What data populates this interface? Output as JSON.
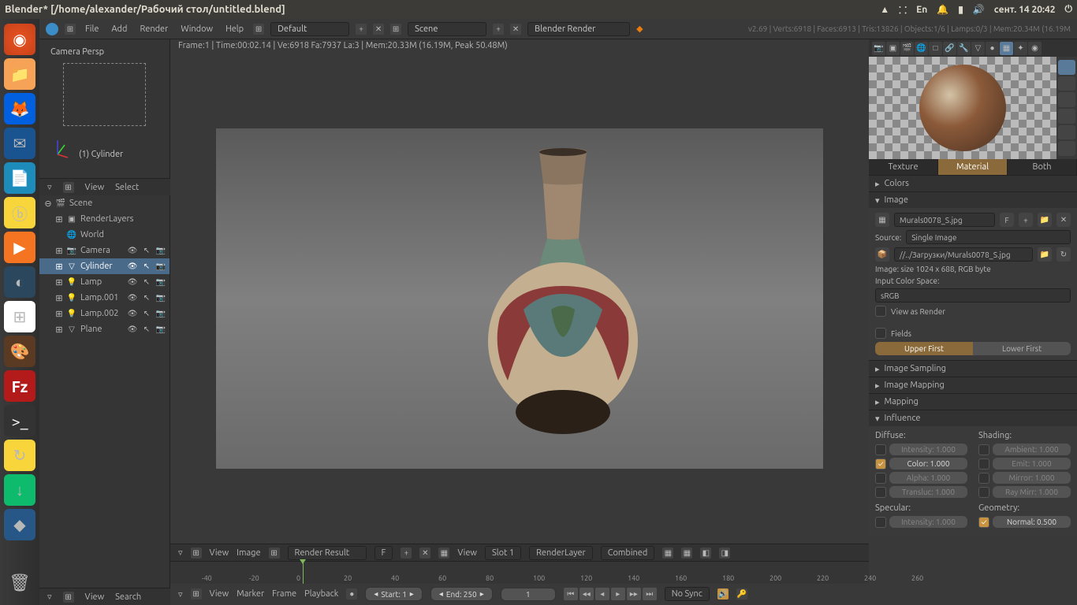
{
  "titlebar": {
    "text": "Blender* [/home/alexander/Рабочий стол/untitled.blend]",
    "lang": "En",
    "datetime": "сент. 14 20:42"
  },
  "toolbar": {
    "menus": [
      "File",
      "Add",
      "Render",
      "Window",
      "Help"
    ],
    "layout": "Default",
    "scene": "Scene",
    "engine": "Blender Render",
    "stats": "v2.69 | Verts:6918 | Faces:6913 | Tris:13826 | Objects:1/6 | Lamps:0/3 | Mem:20.34M (16.19M"
  },
  "camera": {
    "label": "Camera Persp",
    "name": "(1) Cylinder"
  },
  "outliner": {
    "header": [
      "View",
      "Select"
    ],
    "items": [
      {
        "name": "Scene",
        "icon": "🎬",
        "indent": 0,
        "toggle": "⊖",
        "ctrls": false
      },
      {
        "name": "RenderLayers",
        "icon": "▣",
        "indent": 1,
        "toggle": "⊞",
        "ctrls": false
      },
      {
        "name": "World",
        "icon": "🌐",
        "indent": 1,
        "toggle": "",
        "ctrls": false
      },
      {
        "name": "Camera",
        "icon": "📷",
        "indent": 1,
        "toggle": "⊞",
        "ctrls": true
      },
      {
        "name": "Cylinder",
        "icon": "▽",
        "indent": 1,
        "toggle": "⊞",
        "ctrls": true,
        "selected": true
      },
      {
        "name": "Lamp",
        "icon": "💡",
        "indent": 1,
        "toggle": "⊞",
        "ctrls": true
      },
      {
        "name": "Lamp.001",
        "icon": "💡",
        "indent": 1,
        "toggle": "⊞",
        "ctrls": true
      },
      {
        "name": "Lamp.002",
        "icon": "💡",
        "indent": 1,
        "toggle": "⊞",
        "ctrls": true
      },
      {
        "name": "Plane",
        "icon": "▽",
        "indent": 1,
        "toggle": "⊞",
        "ctrls": true
      }
    ]
  },
  "outliner_footer": {
    "view": "View",
    "search": "Search"
  },
  "render_info": "Frame:1 | Time:00:02.14 | Ve:6918 Fa:7937 La:3 | Mem:20.33M (16.19M, Peak 50.48M)",
  "image_toolbar": {
    "view": "View",
    "image": "Image",
    "result": "Render Result",
    "f": "F",
    "view2": "View",
    "slot": "Slot 1",
    "layer": "RenderLayer",
    "pass": "Combined"
  },
  "timeline": {
    "ticks": [
      -40,
      -20,
      0,
      20,
      40,
      60,
      80,
      100,
      120,
      140,
      160,
      180,
      200,
      220,
      240,
      260
    ],
    "menus": [
      "View",
      "Marker",
      "Frame",
      "Playback"
    ],
    "start": "Start: 1",
    "end": "End: 250",
    "current": "1",
    "sync": "No Sync"
  },
  "properties": {
    "tabs": [
      "Texture",
      "Material",
      "Both"
    ],
    "sections": {
      "colors": "Colors",
      "image": "Image",
      "image_file": "Murals0078_S.jpg",
      "f": "F",
      "source_label": "Source:",
      "source": "Single Image",
      "path": "//../Загрузки/Murals0078_S.jpg",
      "size": "Image: size 1024 x 688, RGB byte",
      "colorspace_label": "Input Color Space:",
      "colorspace": "sRGB",
      "view_as_render": "View as Render",
      "fields": "Fields",
      "upper": "Upper First",
      "lower": "Lower First",
      "sampling": "Image Sampling",
      "mapping": "Image Mapping",
      "mapping2": "Mapping",
      "influence": "Influence",
      "diffuse": "Diffuse:",
      "shading": "Shading:",
      "inf_items_l": [
        {
          "label": "Intensity: 1.000",
          "on": false
        },
        {
          "label": "Color: 1.000",
          "on": true
        },
        {
          "label": "Alpha: 1.000",
          "on": false
        },
        {
          "label": "Transluc: 1.000",
          "on": false
        }
      ],
      "inf_items_r": [
        {
          "label": "Ambient: 1.000",
          "on": false
        },
        {
          "label": "Emit: 1.000",
          "on": false
        },
        {
          "label": "Mirror: 1.000",
          "on": false
        },
        {
          "label": "Ray Mirr: 1.000",
          "on": false
        }
      ],
      "specular": "Specular:",
      "geometry": "Geometry:",
      "spec_intensity": "Intensity: 1.000",
      "normal": "Normal: 0.500"
    }
  }
}
